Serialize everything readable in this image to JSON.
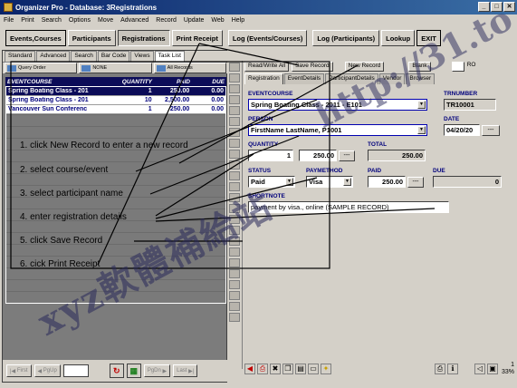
{
  "window": {
    "title": "Organizer Pro - Database: 3Registrations"
  },
  "menu": [
    "File",
    "Print",
    "Search",
    "Options",
    "Move",
    "Advanced",
    "Record",
    "Update",
    "Web",
    "Help"
  ],
  "toolbar": {
    "buttons": [
      "Events,Courses",
      "Participants",
      "Registrations",
      "Print Receipt",
      "Log (Events/Courses)",
      "Log (Participants)",
      "Lookup",
      "EXIT"
    ]
  },
  "left": {
    "view_tabs": [
      "Standard",
      "Advanced",
      "Search",
      "Bar Code",
      "Views",
      "Task List"
    ],
    "filters": [
      "Query Order",
      "NONE",
      "All Records"
    ],
    "columns": [
      "EVENTCOURSE",
      "QUANTITY",
      "PAID",
      "DUE"
    ],
    "rows": [
      {
        "course": "Spring Boating Class - 201",
        "qty": "1",
        "paid": "250.00",
        "due": "0.00"
      },
      {
        "course": "Spring Boating Class - 201",
        "qty": "10",
        "paid": "2,500.00",
        "due": "0.00"
      },
      {
        "course": "Vancouver Sun Conferenc",
        "qty": "1",
        "paid": "250.00",
        "due": "0.00"
      }
    ],
    "nav": {
      "first": "First",
      "pgup": "PgUp",
      "pgdn": "PgDn",
      "last": "Last"
    }
  },
  "right": {
    "top_buttons": [
      "Read/Write All",
      "Save Record",
      "New Record",
      "Blank"
    ],
    "ro_label": "RO",
    "tabs": [
      "Registration",
      "EventDetails",
      "ParticipantDetails",
      "Vendor",
      "Browser"
    ],
    "fields": {
      "eventcourse_label": "EVENTCOURSE",
      "eventcourse_value": "Spring Boating Class - 2011 - E101",
      "trnumber_label": "TRNUMBER",
      "trnumber_value": "TR10001",
      "person_label": "PERSON",
      "person_value": "FirstName LastName, P1001",
      "date_label": "DATE",
      "date_value": "04/20/20",
      "quantity_label": "QUANTITY",
      "quantity_value": "1",
      "price_value": "250.00",
      "total_label": "TOTAL",
      "total_value": "250.00",
      "status_label": "STATUS",
      "status_value": "Paid",
      "paymethod_label": "PAYMETHOD",
      "paymethod_value": "Visa",
      "paid_label": "PAID",
      "paid_value": "250.00",
      "due_label": "DUE",
      "due_value": "0",
      "shortnote_label": "SHORTNOTE",
      "shortnote_value": "payment by visa., online (SAMPLE RECORD)"
    },
    "zoom": "1",
    "percent": "33%"
  },
  "steps": [
    "1.  click New Record to enter a new record",
    "2.  select course/event",
    "3. select participant name",
    "4. enter registration details",
    "5. click Save Record",
    "6. cick Print Receipt"
  ],
  "watermark": {
    "left": "xyz軟體補給站",
    "right": "http://31.to"
  }
}
